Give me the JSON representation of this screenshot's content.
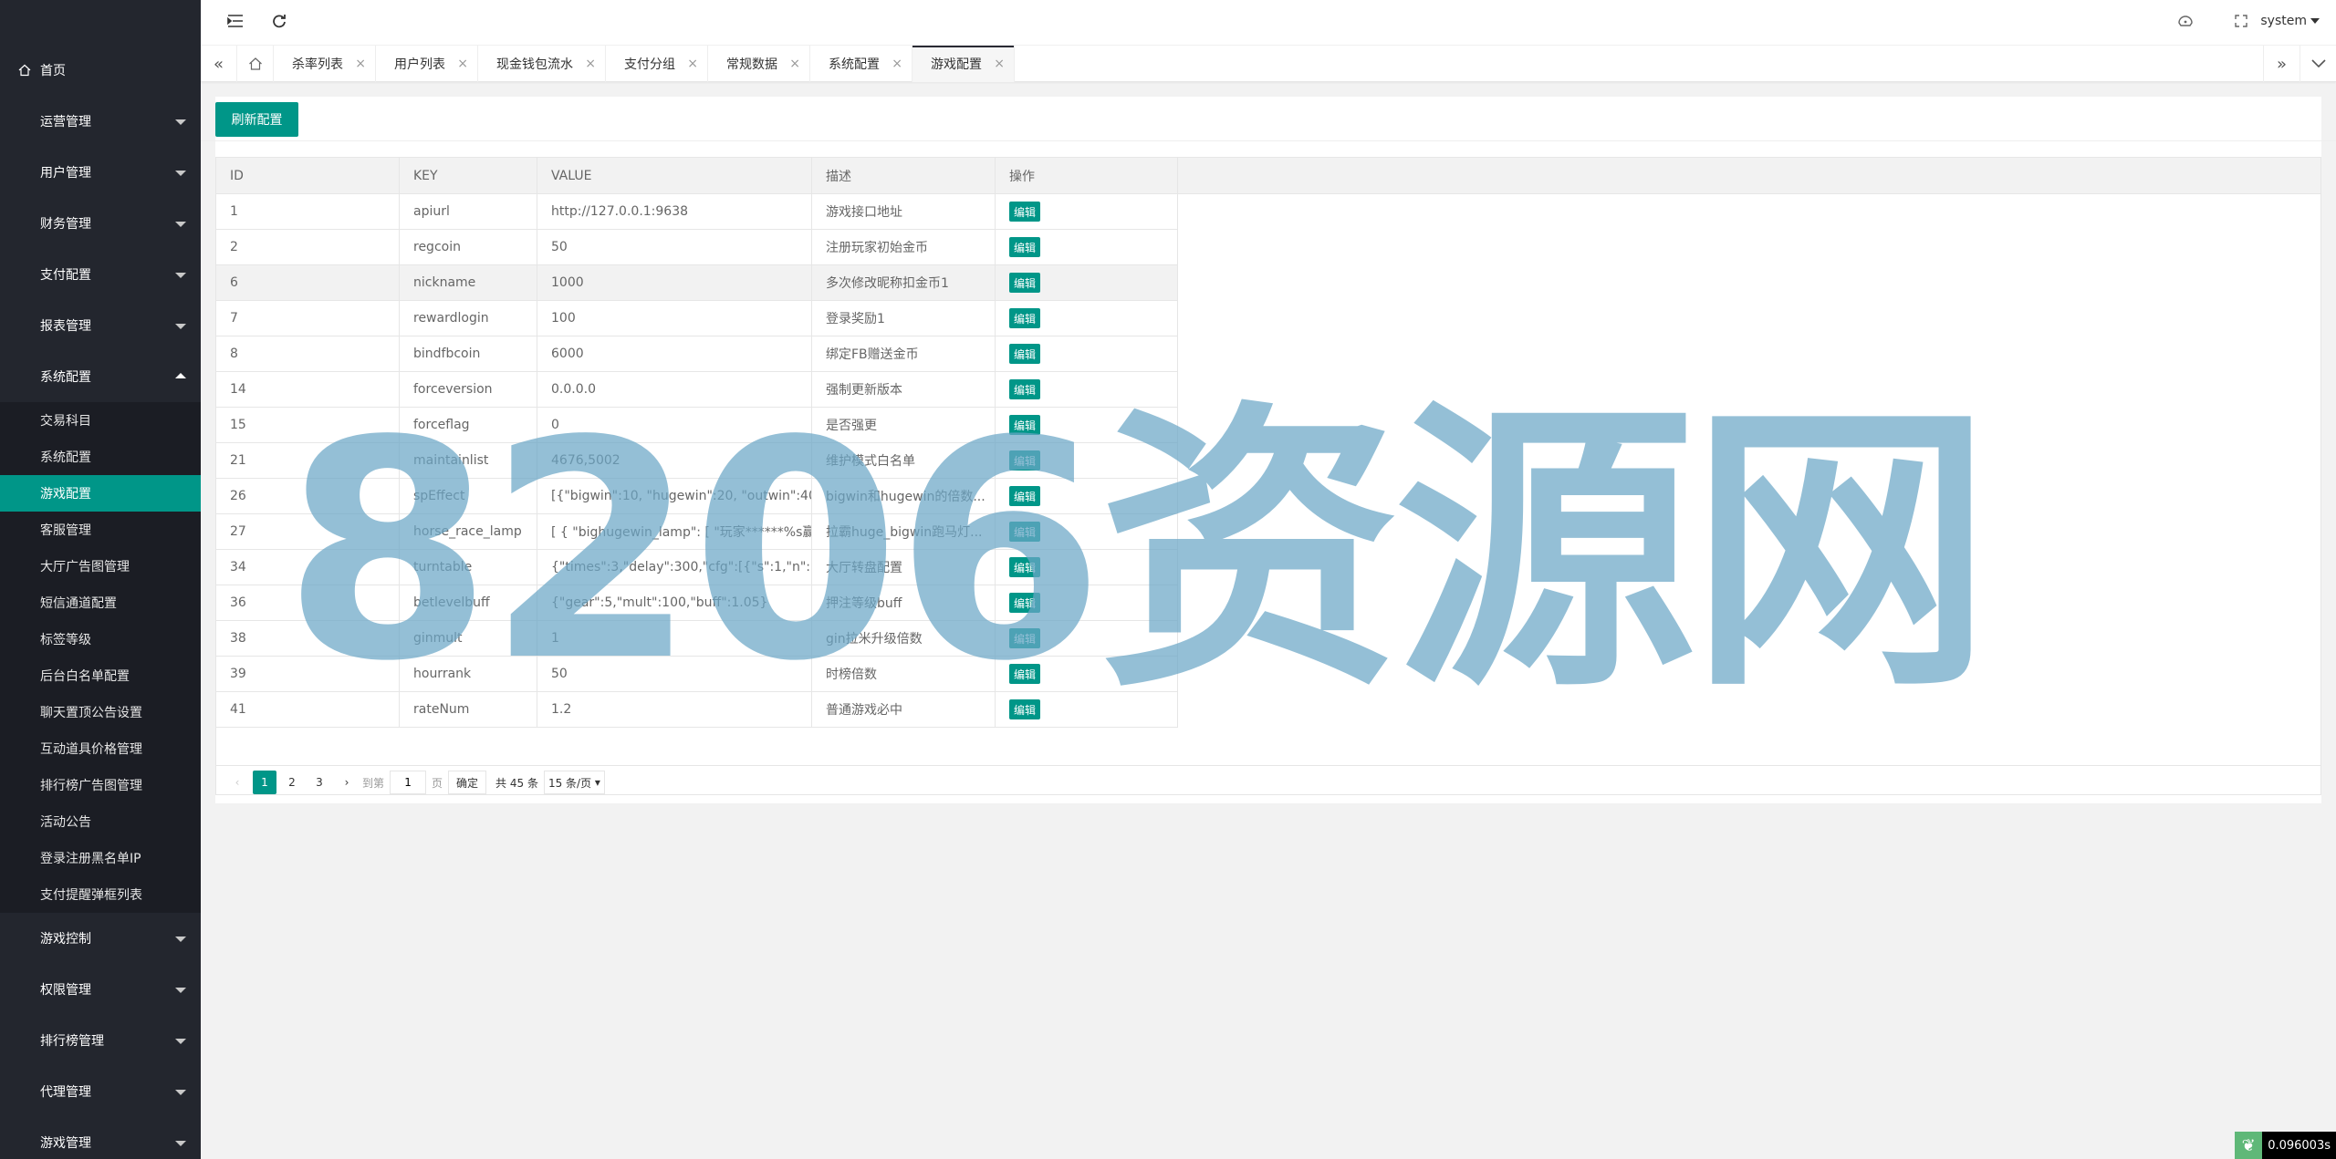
{
  "sidebar": {
    "home": "首页",
    "groups_top": [
      {
        "label": "运营管理"
      },
      {
        "label": "用户管理"
      },
      {
        "label": "财务管理"
      },
      {
        "label": "支付配置"
      },
      {
        "label": "报表管理"
      }
    ],
    "open_group": {
      "label": "系统配置",
      "items": [
        {
          "label": "交易科目"
        },
        {
          "label": "系统配置"
        },
        {
          "label": "游戏配置",
          "active": true
        },
        {
          "label": "客服管理"
        },
        {
          "label": "大厅广告图管理"
        },
        {
          "label": "短信通道配置"
        },
        {
          "label": "标签等级"
        },
        {
          "label": "后台白名单配置"
        },
        {
          "label": "聊天置顶公告设置"
        },
        {
          "label": "互动道具价格管理"
        },
        {
          "label": "排行榜广告图管理"
        },
        {
          "label": "活动公告"
        },
        {
          "label": "登录注册黑名单IP"
        },
        {
          "label": "支付提醒弹框列表"
        }
      ]
    },
    "groups_bottom": [
      {
        "label": "游戏控制"
      },
      {
        "label": "权限管理"
      },
      {
        "label": "排行榜管理"
      },
      {
        "label": "代理管理"
      },
      {
        "label": "游戏管理"
      }
    ]
  },
  "header": {
    "user": "system"
  },
  "tabs": [
    {
      "label": "杀率列表"
    },
    {
      "label": "用户列表"
    },
    {
      "label": "现金钱包流水"
    },
    {
      "label": "支付分组"
    },
    {
      "label": "常规数据"
    },
    {
      "label": "系统配置"
    },
    {
      "label": "游戏配置",
      "active": true
    }
  ],
  "toolbar": {
    "refresh_label": "刷新配置"
  },
  "table": {
    "headers": [
      "ID",
      "KEY",
      "VALUE",
      "描述",
      "操作"
    ],
    "edit_label": "编辑",
    "rows": [
      {
        "id": "1",
        "key": "apiurl",
        "value": "http://127.0.0.1:9638",
        "desc": "游戏接口地址"
      },
      {
        "id": "2",
        "key": "regcoin",
        "value": "50",
        "desc": "注册玩家初始金币"
      },
      {
        "id": "6",
        "key": "nickname",
        "value": "1000",
        "desc": "多次修改昵称扣金币1"
      },
      {
        "id": "7",
        "key": "rewardlogin",
        "value": "100",
        "desc": "登录奖励1"
      },
      {
        "id": "8",
        "key": "bindfbcoin",
        "value": "6000",
        "desc": "绑定FB赠送金币"
      },
      {
        "id": "14",
        "key": "forceversion",
        "value": "0.0.0.0",
        "desc": "强制更新版本"
      },
      {
        "id": "15",
        "key": "forceflag",
        "value": "0",
        "desc": "是否强更"
      },
      {
        "id": "21",
        "key": "maintainlist",
        "value": "4676,5002",
        "desc": "维护模式白名单"
      },
      {
        "id": "26",
        "key": "spEffect",
        "value": "[{\"bigwin\":10, \"hugewin\":20, \"outwin\":40, ...",
        "desc": "bigwin和hugewin的倍数..."
      },
      {
        "id": "27",
        "key": "horse_race_lamp",
        "value": "[ { \"bighugewin_lamp\": [ \"玩家******%s赢...",
        "desc": "拉霸huge_bigwin跑马灯..."
      },
      {
        "id": "34",
        "key": "turntable",
        "value": "{\"times\":3,\"delay\":300,\"cfg\":[{\"s\":1,\"n\":...",
        "desc": "大厅转盘配置"
      },
      {
        "id": "36",
        "key": "betlevelbuff",
        "value": "{\"gear\":5,\"mult\":100,\"buff\":1.05}",
        "desc": "押注等级buff"
      },
      {
        "id": "38",
        "key": "ginmult",
        "value": "1",
        "desc": "gin拉米升级倍数"
      },
      {
        "id": "39",
        "key": "hourrank",
        "value": "50",
        "desc": "时榜倍数"
      },
      {
        "id": "41",
        "key": "rateNum",
        "value": "1.2",
        "desc": "普通游戏必中"
      }
    ]
  },
  "pager": {
    "pages": [
      "1",
      "2",
      "3"
    ],
    "current": "1",
    "goto_label": "到第",
    "goto_value": "1",
    "page_label": "页",
    "ok_label": "确定",
    "total": "共 45 条",
    "per_page": "15 条/页"
  },
  "watermark": "8206资源网",
  "perf": "0.096003s"
}
